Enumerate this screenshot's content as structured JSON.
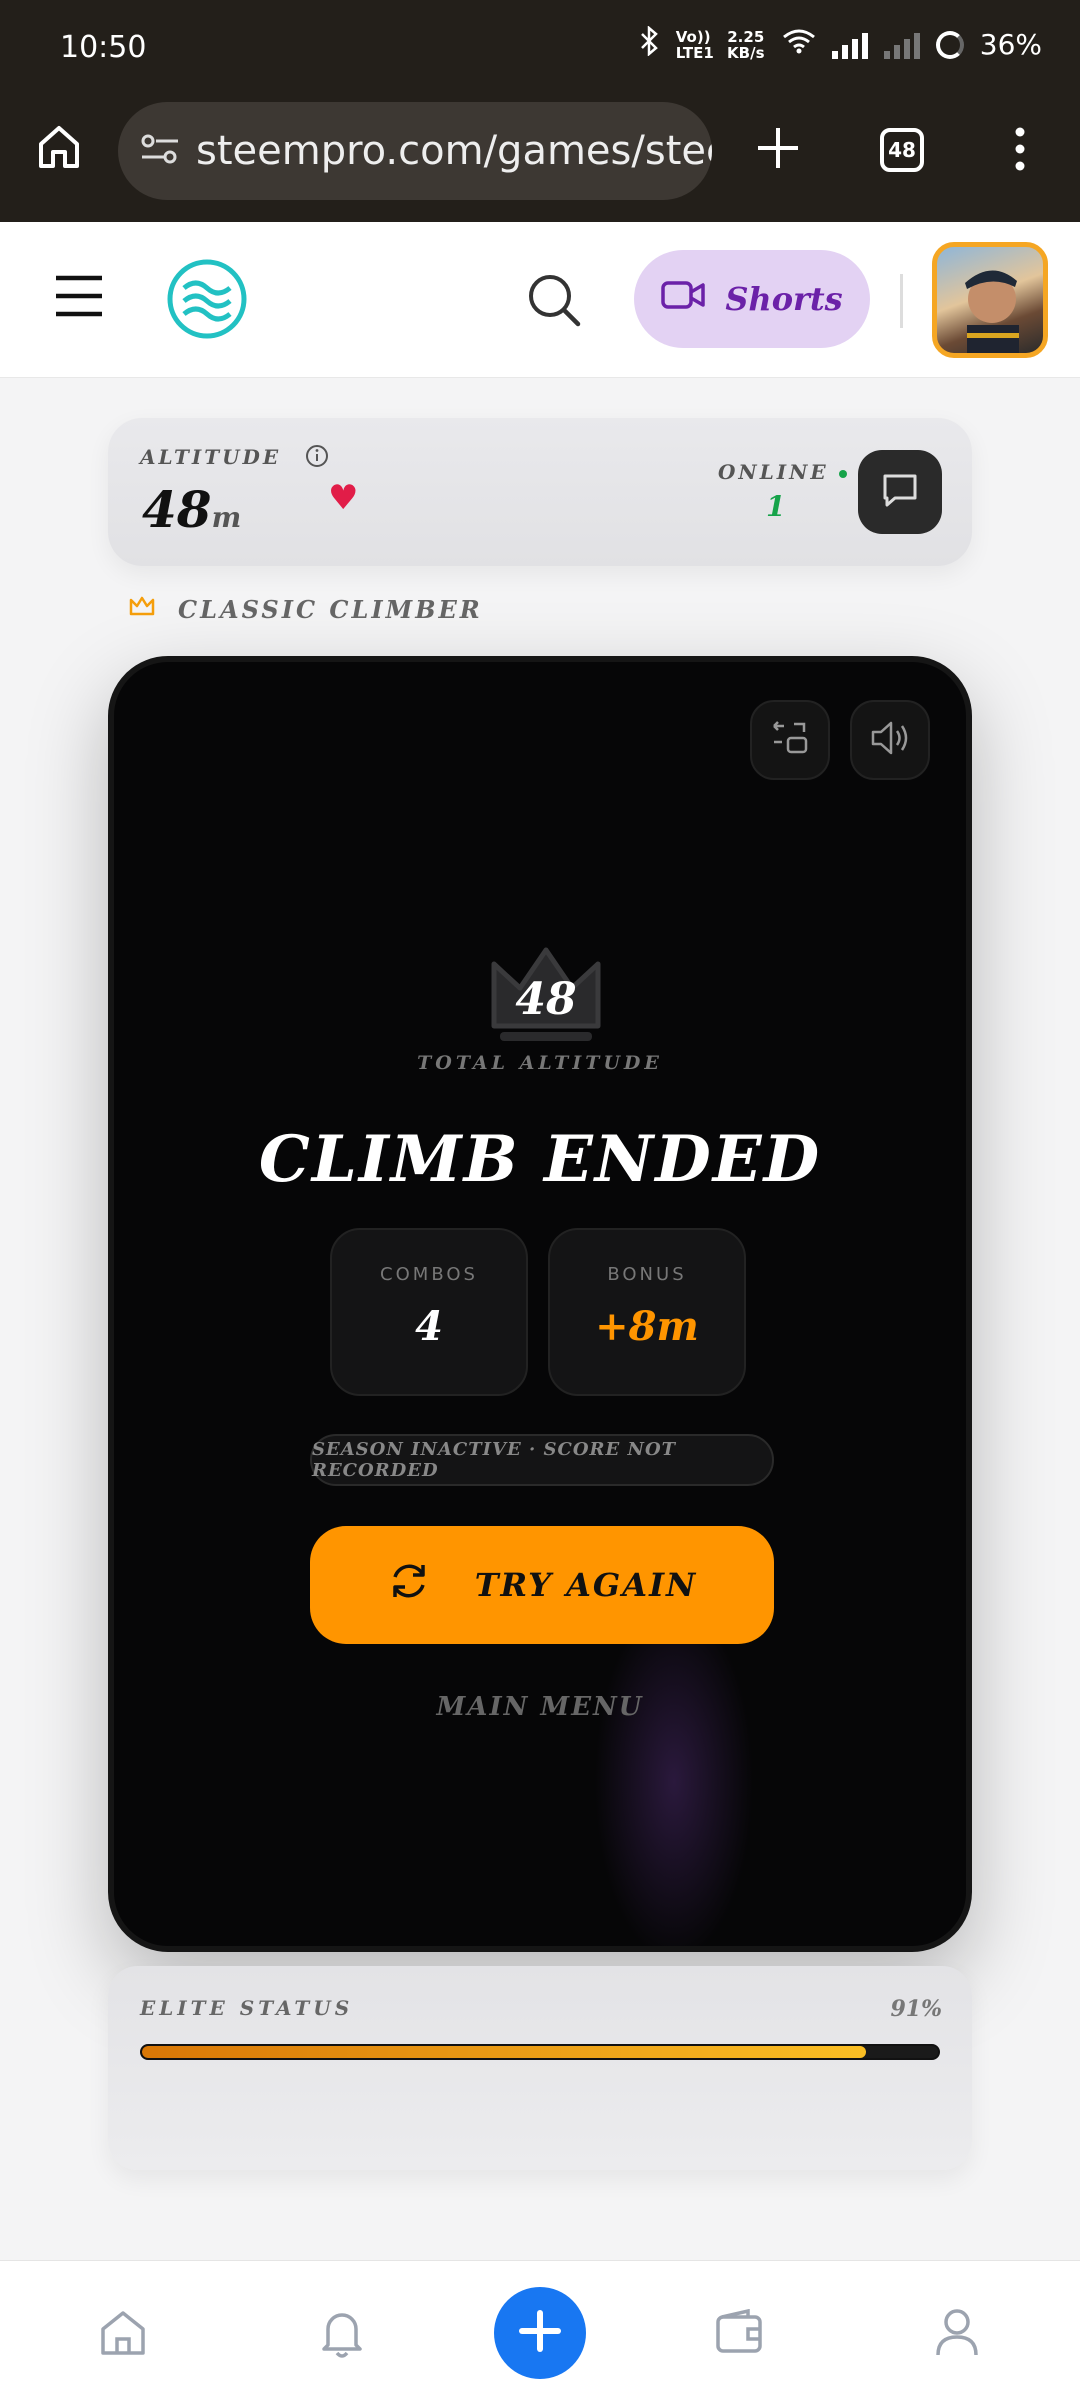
{
  "status_bar": {
    "time": "10:50",
    "volte": "Vo)) LTE1",
    "speed": "2.25 KB/s",
    "battery": "36%"
  },
  "browser": {
    "url": "steempro.com/games/steer",
    "tab_count": "48"
  },
  "header": {
    "shorts_label": "Shorts"
  },
  "altitude_card": {
    "label": "ALTITUDE",
    "value": "48",
    "unit": "m",
    "online_label": "ONLINE",
    "online_count": "1"
  },
  "mode": {
    "label": "CLASSIC CLIMBER"
  },
  "game": {
    "score": "48",
    "total_label": "TOTAL ALTITUDE",
    "title": "CLIMB ENDED",
    "combos_label": "COMBOS",
    "combos_value": "4",
    "bonus_label": "BONUS",
    "bonus_value": "+8m",
    "season_note": "SEASON INACTIVE · SCORE NOT RECORDED",
    "try_again_label": "TRY AGAIN",
    "main_menu_label": "MAIN MENU"
  },
  "elite": {
    "label": "ELITE STATUS",
    "percent_text": "91%",
    "progress": 0.91
  },
  "colors": {
    "accent_orange": "#ff9500",
    "online_green": "#16a34a",
    "brand_teal": "#22c1c3",
    "fab_blue": "#1877f2"
  },
  "icons": [
    "home-icon",
    "tune-icon",
    "plus-icon",
    "menu-icon",
    "steem-logo",
    "search-icon",
    "video-icon",
    "info-icon",
    "heart-icon",
    "chat-icon",
    "crown-icon",
    "swap-icon",
    "sound-icon",
    "refresh-icon",
    "bell-icon",
    "wallet-icon",
    "user-icon"
  ]
}
